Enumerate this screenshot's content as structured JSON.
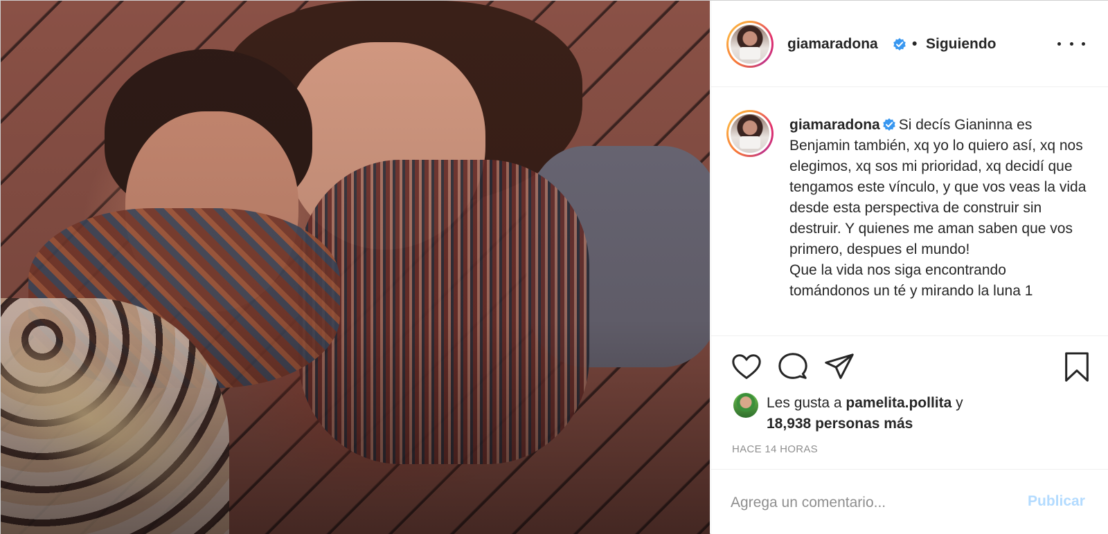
{
  "post": {
    "username": "giamaradona",
    "verified_icon": "verified-badge-icon",
    "follow_separator": "•",
    "follow_status": "Siguiendo",
    "more_icon": "more-options-icon"
  },
  "caption": {
    "username": "giamaradona",
    "text": "Si decís Gianinna es Benjamin también, xq yo lo quiero así, xq nos elegimos, xq sos mi prioridad, xq decidí que tengamos este vínculo, y que vos veas la vida desde esta perspectiva de construir sin destruir. Y quienes me aman saben que vos primero, despues el mundo!\nQue la vida nos siga encontrando tomándonos un té y mirando la luna 1"
  },
  "actions": {
    "like_icon": "heart-icon",
    "comment_icon": "comment-icon",
    "share_icon": "paper-plane-icon",
    "save_icon": "bookmark-icon"
  },
  "likes": {
    "prefix": "Les gusta a ",
    "liker": "pamelita.pollita",
    "suffix": " y",
    "count_text": "18,938 personas más"
  },
  "timestamp": "HACE 14 HORAS",
  "comment_box": {
    "placeholder": "Agrega un comentario...",
    "publish_label": "Publicar"
  },
  "colors": {
    "verified": "#3897f0",
    "publish_disabled": "#b3dbff",
    "meta_text": "#8e8e8e"
  }
}
